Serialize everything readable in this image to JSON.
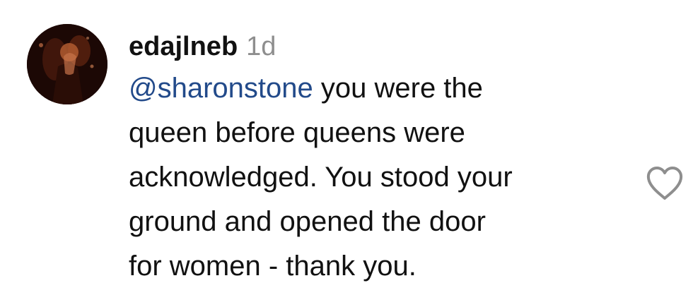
{
  "comment": {
    "username": "edajlneb",
    "time": "1d",
    "mention": "@sharonstone",
    "lines": [
      " you were the",
      "queen before queens were",
      "acknowledged. You stood your",
      "ground and opened the door",
      "for women - thank you."
    ],
    "avatar_icon": "profile-photo",
    "like_icon": "heart-outline-icon"
  },
  "colors": {
    "text": "#111111",
    "mention": "#224a8a",
    "muted": "#8e8e8e",
    "heart_stroke": "#8e8e8e"
  }
}
